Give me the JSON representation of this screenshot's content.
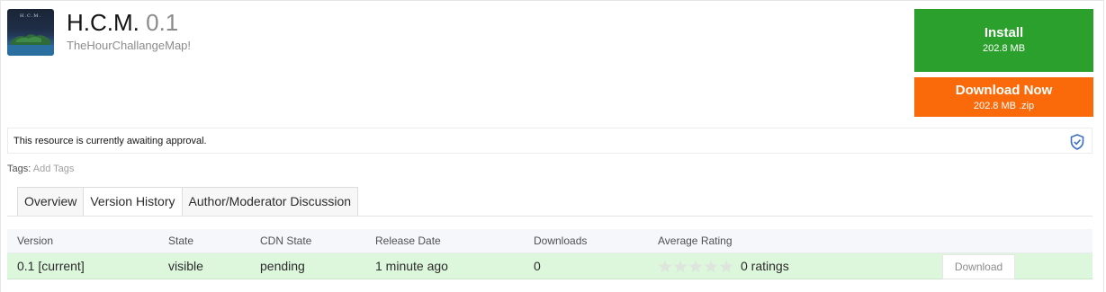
{
  "resource": {
    "title": "H.C.M.",
    "version": "0.1",
    "tagline": "TheHourChallangeMap!",
    "thumbnail_text": "H.C.M."
  },
  "actions": {
    "install_label": "Install",
    "install_size": "202.8 MB",
    "download_label": "Download Now",
    "download_size": "202.8 MB .zip"
  },
  "notice": {
    "message": "This resource is currently awaiting approval.",
    "icon": "shield-check-icon"
  },
  "tags": {
    "label": "Tags:",
    "add_label": "Add Tags"
  },
  "tabs": [
    {
      "label": "Overview",
      "active": false
    },
    {
      "label": "Version History",
      "active": true
    },
    {
      "label": "Author/Moderator Discussion",
      "active": false
    }
  ],
  "versions": {
    "headers": [
      "Version",
      "State",
      "CDN State",
      "Release Date",
      "Downloads",
      "Average Rating"
    ],
    "rows": [
      {
        "version": "0.1 [current]",
        "state": "visible",
        "cdn_state": "pending",
        "release_date": "1 minute ago",
        "downloads": "0",
        "rating_stars": 0,
        "ratings": "0 ratings",
        "download_label": "Download"
      }
    ]
  },
  "colors": {
    "install": "#2ca02c",
    "download": "#fa6a0a",
    "row_highlight": "#ddf7dd",
    "shield": "#3d6fc4"
  }
}
